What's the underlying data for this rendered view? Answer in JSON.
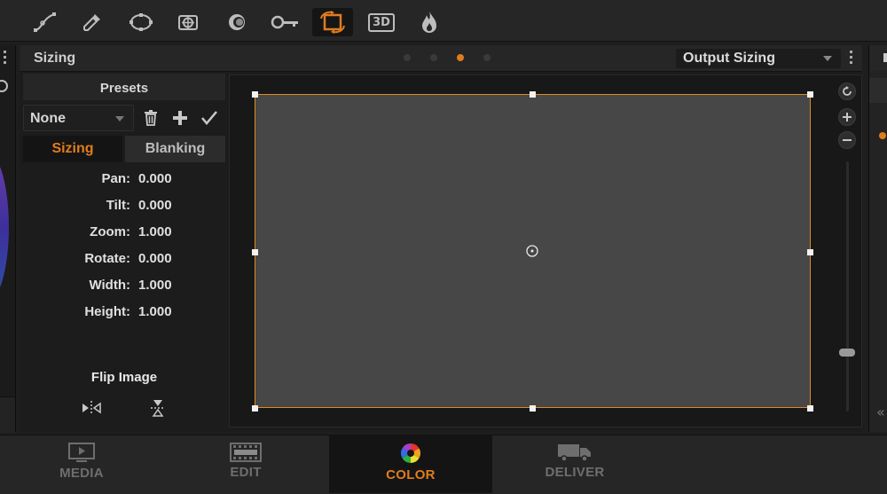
{
  "toolbar": {
    "tools": [
      {
        "name": "curve-tool",
        "icon": "curve-icon"
      },
      {
        "name": "qualifier-tool",
        "icon": "eyedropper-icon"
      },
      {
        "name": "window-tool",
        "icon": "power-window-icon"
      },
      {
        "name": "tracker-tool",
        "icon": "tracker-icon"
      },
      {
        "name": "blur-tool",
        "icon": "blur-icon"
      },
      {
        "name": "key-tool",
        "icon": "key-icon"
      },
      {
        "name": "sizing-tool",
        "icon": "sizing-icon",
        "active": true
      },
      {
        "name": "stereo-3d-tool",
        "icon": "3d-icon",
        "label": "3D"
      },
      {
        "name": "fx-tool",
        "icon": "flame-icon"
      }
    ]
  },
  "panel": {
    "title": "Sizing",
    "page_dots": 4,
    "active_dot": 3,
    "mode": "Output Sizing"
  },
  "presets": {
    "title": "Presets",
    "selected": "None"
  },
  "tabs": {
    "sizing": "Sizing",
    "blanking": "Blanking"
  },
  "properties": [
    {
      "label": "Pan:",
      "value": "0.000"
    },
    {
      "label": "Tilt:",
      "value": "0.000"
    },
    {
      "label": "Zoom:",
      "value": "1.000"
    },
    {
      "label": "Rotate:",
      "value": "0.000"
    },
    {
      "label": "Width:",
      "value": "1.000"
    },
    {
      "label": "Height:",
      "value": "1.000"
    }
  ],
  "flip": {
    "title": "Flip Image"
  },
  "colors": {
    "accent": "#e07c1e",
    "frame_fill": "#474747",
    "frame_border": "#e08a1e"
  },
  "pages": [
    {
      "label": "MEDIA",
      "icon": "media-icon"
    },
    {
      "label": "EDIT",
      "icon": "edit-icon"
    },
    {
      "label": "COLOR",
      "icon": "color-wheel-icon",
      "active": true
    },
    {
      "label": "DELIVER",
      "icon": "deliver-truck-icon"
    }
  ]
}
